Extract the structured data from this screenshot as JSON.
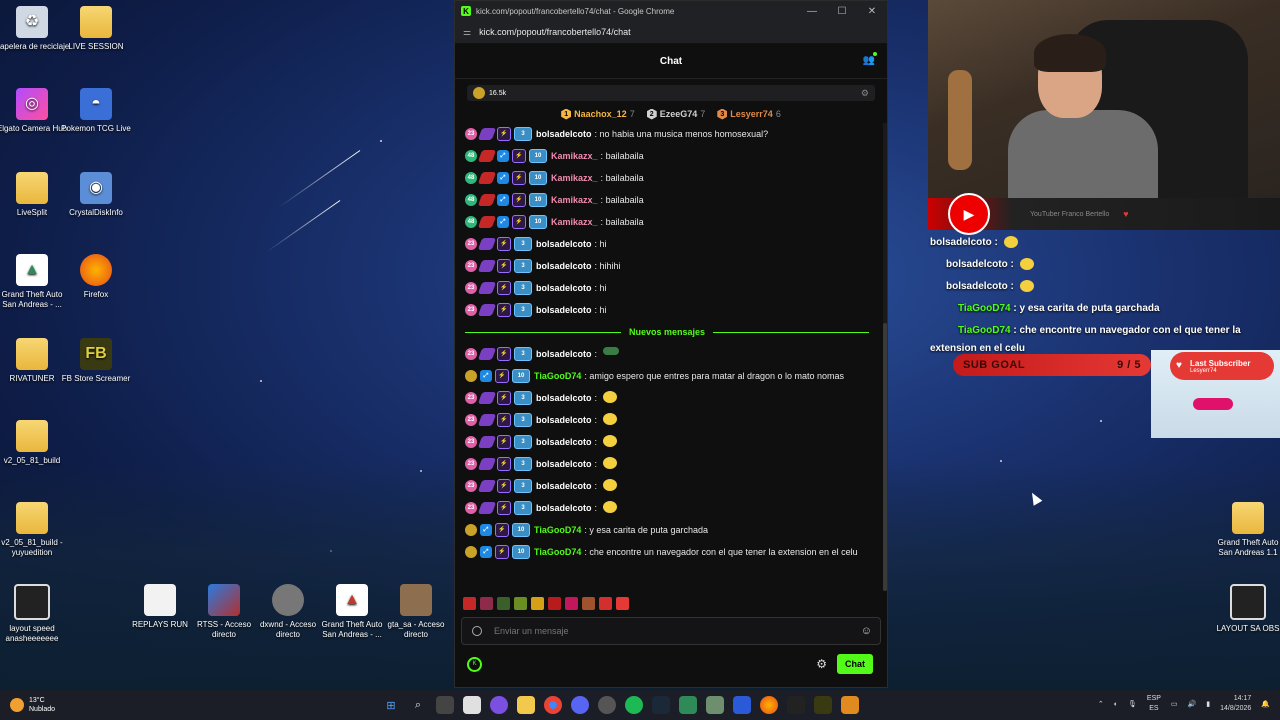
{
  "desktop": {
    "icons": [
      {
        "label": "Papelera de reciclaje",
        "icon": "recycle-bin-icon"
      },
      {
        "label": "LIVE SESSION",
        "icon": "folder-icon"
      },
      {
        "label": "Elgato Camera Hub",
        "icon": "elgato-icon"
      },
      {
        "label": "Pokemon TCG Live",
        "icon": "pokeball-icon"
      },
      {
        "label": "LiveSplit",
        "icon": "folder-icon"
      },
      {
        "label": "CrystalDiskInfo",
        "icon": "disk-icon"
      },
      {
        "label": "Grand Theft Auto San Andreas - ...",
        "icon": "gta-icon"
      },
      {
        "label": "Firefox",
        "icon": "firefox-icon"
      },
      {
        "label": "RIVATUNER",
        "icon": "folder-icon"
      },
      {
        "label": "FB Store Screamer",
        "icon": "fb-icon"
      },
      {
        "label": "v2_05_81_build",
        "icon": "folder-icon"
      },
      {
        "label": "v2_05_81_build - yuyuedition",
        "icon": "folder-icon"
      },
      {
        "label": "layout speed anasheeeeeee",
        "icon": "screen-icon"
      },
      {
        "label": "REPLAYS RUN",
        "icon": "file-icon"
      },
      {
        "label": "RTSS - Acceso directo",
        "icon": "rtss-icon"
      },
      {
        "label": "dxwnd - Acceso directo",
        "icon": "dxwnd-icon"
      },
      {
        "label": "Grand Theft Auto San Andreas - ...",
        "icon": "gta-icon"
      },
      {
        "label": "gta_sa - Acceso directo",
        "icon": "gta-sa-icon"
      },
      {
        "label": "Grand Theft Auto San Andreas 1.1",
        "icon": "folder-icon"
      },
      {
        "label": "LAYOUT SA OBS",
        "icon": "screen-icon"
      }
    ]
  },
  "browser": {
    "title": "kick.com/popout/francobertello74/chat - Google Chrome",
    "url": "kick.com/popout/francobertello74/chat",
    "controls": {
      "minimize": "—",
      "maximize": "☐",
      "close": "✕"
    }
  },
  "chat": {
    "header": "Chat",
    "pinned_count": "16.5k",
    "leaders": [
      {
        "rank": "1",
        "name": "Naachox_12",
        "count": "7",
        "color": "#f5b642"
      },
      {
        "rank": "2",
        "name": "EzeeG74",
        "count": "7",
        "color": "#d0d0d0"
      },
      {
        "rank": "3",
        "name": "Lesyerr74",
        "count": "6",
        "color": "#e08a4a"
      }
    ],
    "messages_before": [
      {
        "user": "bolsadelcoto",
        "color": "#ffffff",
        "badges": "b1",
        "sub": "3",
        "text": "no habia una musica menos homosexual?"
      },
      {
        "user": "Kamikazx_",
        "color": "#f28bb0",
        "badges": "b2",
        "sub": "10",
        "text": "bailabaila"
      },
      {
        "user": "Kamikazx_",
        "color": "#f28bb0",
        "badges": "b2",
        "sub": "10",
        "text": "bailabaila"
      },
      {
        "user": "Kamikazx_",
        "color": "#f28bb0",
        "badges": "b2",
        "sub": "10",
        "text": "bailabaila"
      },
      {
        "user": "Kamikazx_",
        "color": "#f28bb0",
        "badges": "b2",
        "sub": "10",
        "text": "bailabaila"
      },
      {
        "user": "bolsadelcoto",
        "color": "#ffffff",
        "badges": "b1",
        "sub": "3",
        "text": "hi"
      },
      {
        "user": "bolsadelcoto",
        "color": "#ffffff",
        "badges": "b1",
        "sub": "3",
        "text": "hihihi"
      },
      {
        "user": "bolsadelcoto",
        "color": "#ffffff",
        "badges": "b1",
        "sub": "3",
        "text": "hi"
      },
      {
        "user": "bolsadelcoto",
        "color": "#ffffff",
        "badges": "b1",
        "sub": "3",
        "text": "hi"
      }
    ],
    "new_messages_label": "Nuevos mensajes",
    "messages_after": [
      {
        "user": "bolsadelcoto",
        "color": "#ffffff",
        "badges": "b1",
        "sub": "3",
        "text": "",
        "emote": "car"
      },
      {
        "user": "TiaGooD74",
        "color": "#53fc18",
        "badges": "b3",
        "sub": "10",
        "text": "amigo espero que entres para matar al dragon o lo mato nomas"
      },
      {
        "user": "bolsadelcoto",
        "color": "#ffffff",
        "badges": "b1",
        "sub": "3",
        "text": "",
        "emote": "smile"
      },
      {
        "user": "bolsadelcoto",
        "color": "#ffffff",
        "badges": "b1",
        "sub": "3",
        "text": "",
        "emote": "smile"
      },
      {
        "user": "bolsadelcoto",
        "color": "#ffffff",
        "badges": "b1",
        "sub": "3",
        "text": "",
        "emote": "smile"
      },
      {
        "user": "bolsadelcoto",
        "color": "#ffffff",
        "badges": "b1",
        "sub": "3",
        "text": "",
        "emote": "smile"
      },
      {
        "user": "bolsadelcoto",
        "color": "#ffffff",
        "badges": "b1",
        "sub": "3",
        "text": "",
        "emote": "smile"
      },
      {
        "user": "bolsadelcoto",
        "color": "#ffffff",
        "badges": "b1",
        "sub": "3",
        "text": "",
        "emote": "smile"
      },
      {
        "user": "TiaGooD74",
        "color": "#53fc18",
        "badges": "b3",
        "sub": "10",
        "text": "y esa carita de puta garchada"
      },
      {
        "user": "TiaGooD74",
        "color": "#53fc18",
        "badges": "b3",
        "sub": "10",
        "text": "che encontre un navegador con el que tener la extension en el celu"
      }
    ],
    "input_placeholder": "Enviar un mensaje",
    "send_button": "Chat"
  },
  "stream_overlay": {
    "yt_text": "YouTuber Franco Bertello",
    "chat_lines": [
      {
        "user": "bolsadelcoto",
        "text": ""
      },
      {
        "user": "bolsadelcoto",
        "text": ""
      },
      {
        "user": "bolsadelcoto",
        "text": ""
      },
      {
        "user": "TiaGooD74",
        "text": "y esa carita de puta garchada"
      },
      {
        "user": "TiaGooD74",
        "text": "che encontre un navegador con el que tener la extension en el celu"
      }
    ],
    "sub_goal_label": "SUB GOAL",
    "sub_goal_value": "9 / 5",
    "last_subscriber_label": "Last Subscriber",
    "last_subscriber_name": "Lesyerr74"
  },
  "taskbar": {
    "temperature": "13°C",
    "weather": "Nublado",
    "lang_top": "ESP",
    "lang_bottom": "ES",
    "time": "14:17",
    "date": "14/8/2026"
  }
}
